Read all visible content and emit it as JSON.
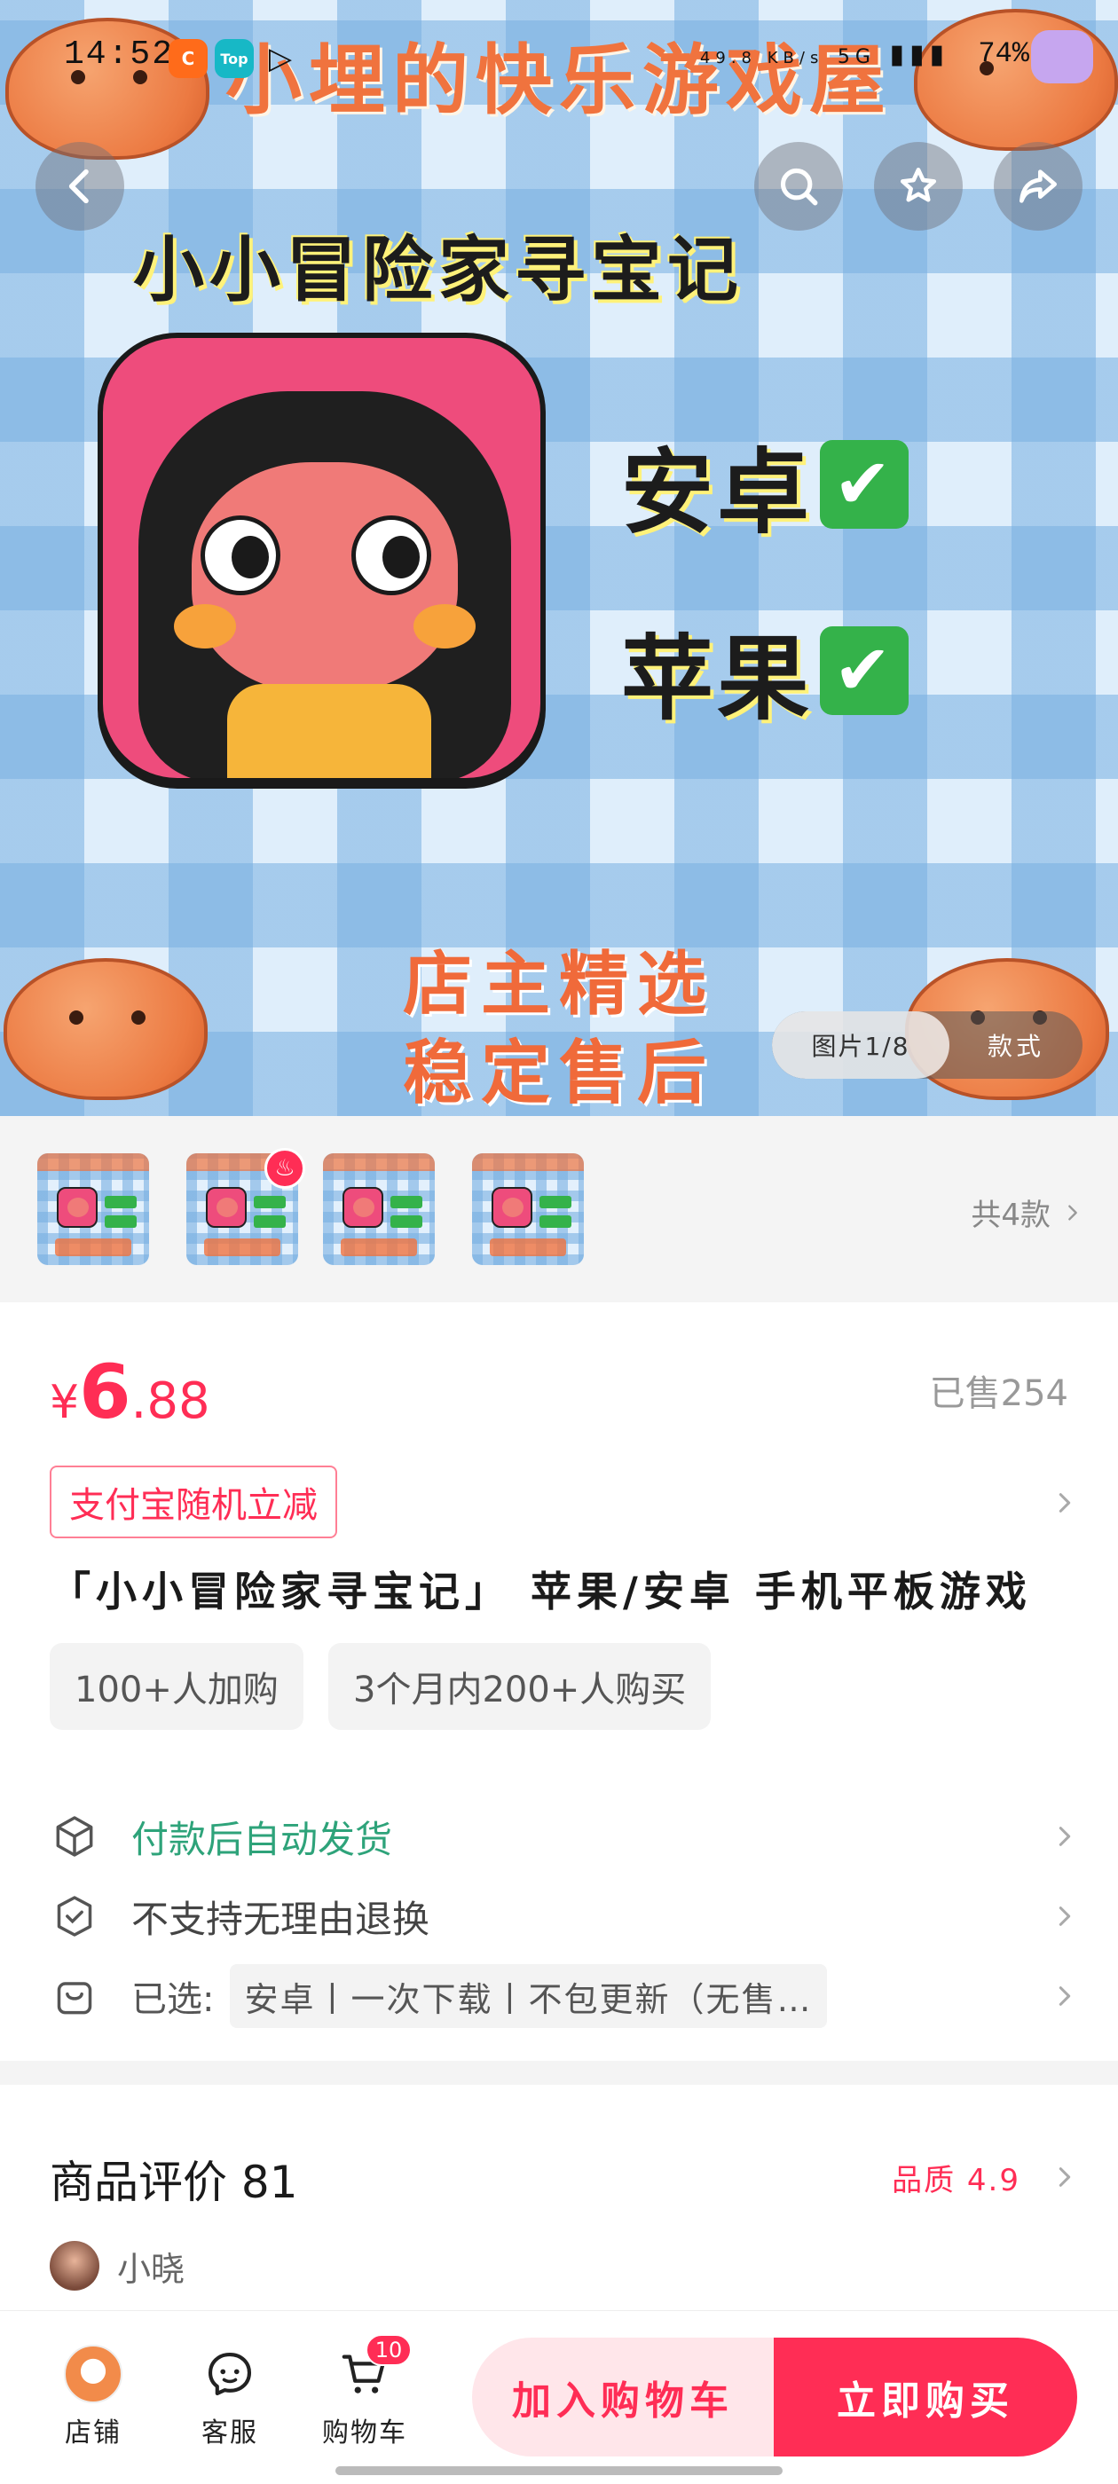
{
  "status_bar": {
    "time": "14:52",
    "net_speed": "49.8 KB/s",
    "network": "5G",
    "battery": "74%"
  },
  "hero": {
    "shop_banner": "小埋的快乐游戏屋",
    "game_title": "小小冒险家寻宝记",
    "platform_android": "安卓",
    "platform_apple": "苹果",
    "check_mark": "✔",
    "footer_line1": "店主精选",
    "footer_line2": "稳定售后",
    "image_counter": "图片1/8",
    "style_label": "款式"
  },
  "variants": {
    "count_label": "共4款",
    "hot_icon": "fire-icon"
  },
  "product": {
    "price_currency": "¥",
    "price_integer": "6",
    "price_decimal": ".88",
    "sold": "已售254",
    "promo": "支付宝随机立减",
    "title": "「小小冒险家寻宝记」 苹果/安卓 手机平板游戏",
    "chips": [
      "100+人加购",
      "3个月内200+人购买"
    ],
    "services": {
      "delivery": "付款后自动发货",
      "returns": "不支持无理由退换",
      "selected_label": "已选:",
      "selected_value": "安卓丨一次下载丨不包更新（无售…"
    }
  },
  "reviews": {
    "title": "商品评价 81",
    "quality": "品质 4.9",
    "first_user": "小晓"
  },
  "bottom_bar": {
    "store": "店铺",
    "service": "客服",
    "cart": "购物车",
    "cart_count": "10",
    "add_to_cart": "加入购物车",
    "buy_now": "立即购买"
  },
  "colors": {
    "accent": "#ff2d55",
    "green": "#2ea37a"
  }
}
